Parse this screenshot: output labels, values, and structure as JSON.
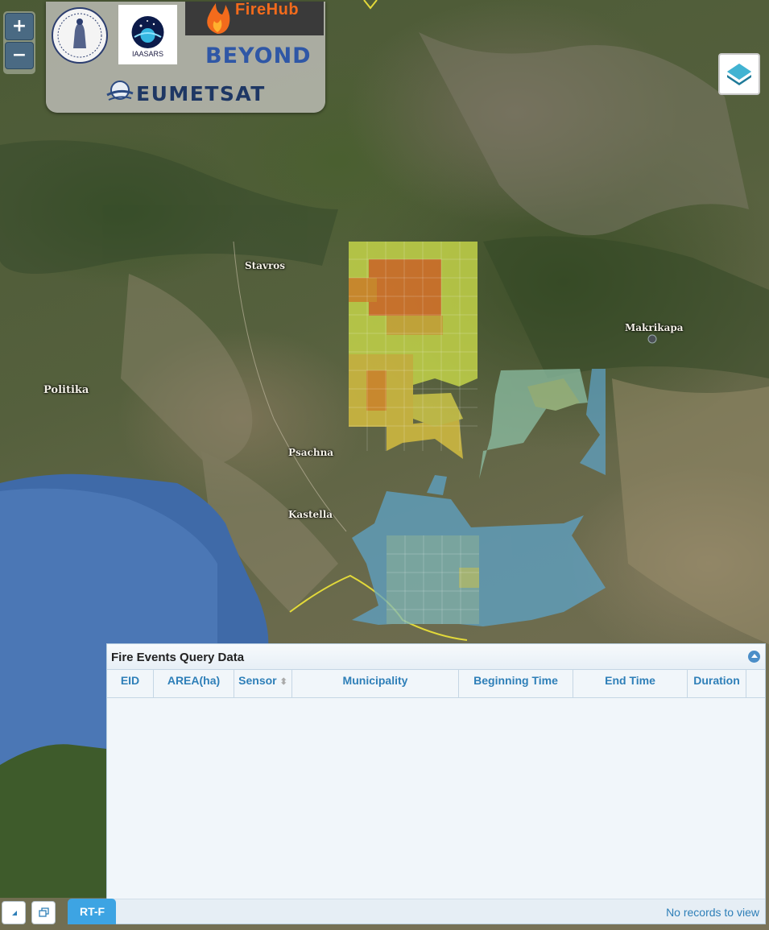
{
  "map": {
    "zoom_in_label": "+",
    "zoom_out_label": "−",
    "place_labels": [
      "Stavros",
      "Makrikapa",
      "Politika",
      "Psachna",
      "Kastella"
    ],
    "colors": {
      "sea": "#3f6aa8",
      "burn_high": "#e0762a",
      "burn_medium": "#d8b23a",
      "burn_low": "#c8d84a",
      "burn_recent": "#5ea3c7"
    }
  },
  "logos": {
    "iaasars_label": "IAASARS",
    "firehub_label": "FireHub",
    "beyond_label": "BEYOND",
    "eumetsat_label": "EUMETSAT"
  },
  "query_panel": {
    "title": "Fire Events Query Data",
    "columns": [
      "EID",
      "AREA(ha)",
      "Sensor",
      "Municipality",
      "Beginning Time",
      "End Time",
      "Duration"
    ],
    "records_text": "No records to view"
  },
  "toolbar": {
    "tab_label": "RT-F",
    "icons": [
      "pointer-icon",
      "window-icon"
    ]
  }
}
